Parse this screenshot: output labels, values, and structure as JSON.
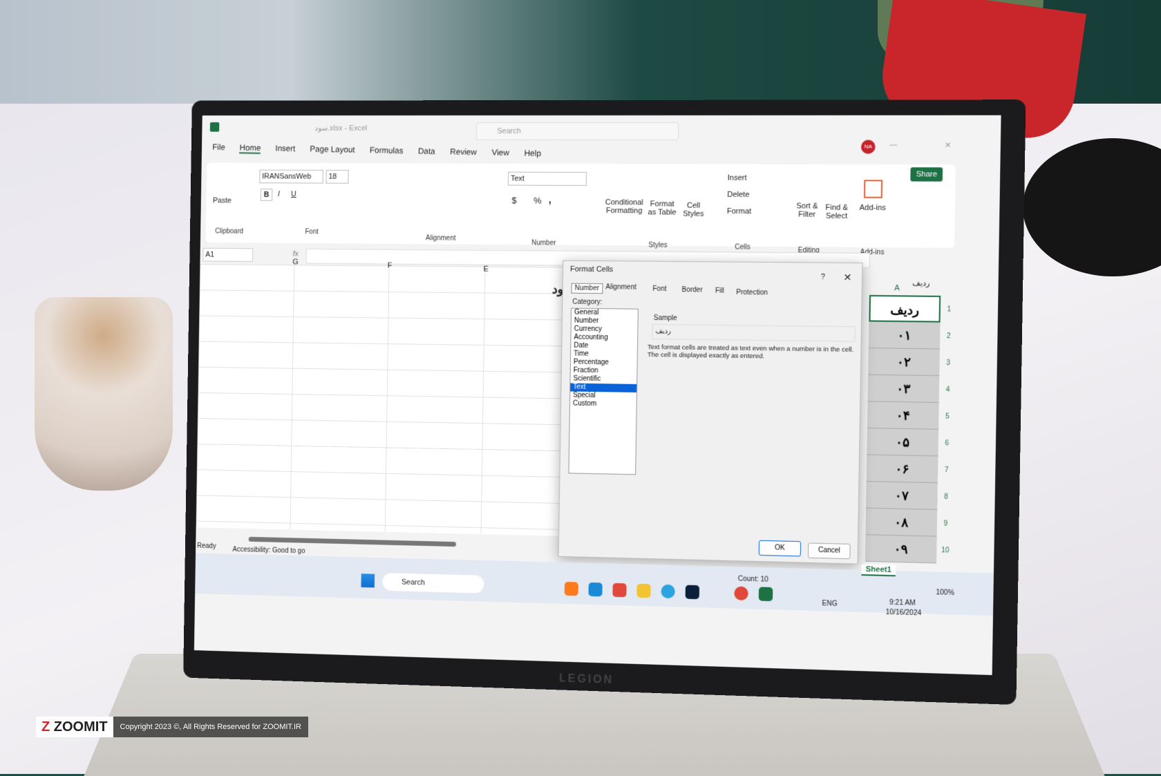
{
  "window": {
    "title": "سود.xlsx - Excel",
    "search_placeholder": "Search",
    "user_initials": "NA",
    "share_label": "Share"
  },
  "menu": [
    "File",
    "Home",
    "Insert",
    "Page Layout",
    "Formulas",
    "Data",
    "Review",
    "View",
    "Help"
  ],
  "ribbon": {
    "clipboard": {
      "paste": "Paste",
      "group": "Clipboard"
    },
    "font": {
      "name": "IRANSansWeb",
      "size": "18",
      "bold": "B",
      "italic": "I",
      "underline": "U",
      "group": "Font"
    },
    "alignment": {
      "group": "Alignment"
    },
    "number": {
      "format": "Text",
      "currency": "$",
      "percent": "%",
      "comma": ",",
      "group": "Number"
    },
    "styles": {
      "conditional": "Conditional Formatting",
      "format_table": "Format as Table",
      "cell_styles": "Cell Styles",
      "group": "Styles"
    },
    "cells": {
      "insert": "Insert",
      "delete": "Delete",
      "format": "Format",
      "group": "Cells"
    },
    "editing": {
      "sort": "Sort & Filter",
      "find": "Find & Select",
      "group": "Editing"
    },
    "addins": {
      "label": "Add-ins",
      "group": "Add-ins"
    }
  },
  "formula_bar": {
    "name_box": "A1",
    "fx": "fx",
    "right_name": "ردیف"
  },
  "columns": [
    "G",
    "F",
    "E",
    "A"
  ],
  "partial_cell": "ود",
  "rows": [
    "1",
    "2",
    "3",
    "4",
    "5",
    "6",
    "7",
    "8",
    "9",
    "10"
  ],
  "column_a": [
    "ردیف",
    "۰۱",
    "۰۲",
    "۰۳",
    "۰۴",
    "۰۵",
    "۰۶",
    "۰۷",
    "۰۸",
    "۰۹"
  ],
  "dialog": {
    "title": "Format Cells",
    "help": "?",
    "tabs": [
      "Number",
      "Alignment",
      "Font",
      "Border",
      "Fill",
      "Protection"
    ],
    "category_label": "Category:",
    "categories": [
      "General",
      "Number",
      "Currency",
      "Accounting",
      "Date",
      "Time",
      "Percentage",
      "Fraction",
      "Scientific",
      "Text",
      "Special",
      "Custom"
    ],
    "selected_category": "Text",
    "sample_label": "Sample",
    "sample_value": "ردیف",
    "description": "Text format cells are treated as text even when a number is in the cell. The cell is displayed exactly as entered.",
    "ok": "OK",
    "cancel": "Cancel"
  },
  "status": {
    "ready": "Ready",
    "accessibility": "Accessibility: Good to go",
    "count": "Count: 10",
    "zoom": "100%",
    "sheet": "Sheet1"
  },
  "taskbar": {
    "search": "Search",
    "lang": "ENG",
    "time": "9:21 AM",
    "date": "10/16/2024"
  },
  "laptop_brand": "LEGION",
  "watermark": {
    "logo": "ZOOMIT",
    "copyright": "Copyright 2023 ©, All Rights Reserved for ZOOMIT.IR"
  },
  "colors": {
    "excel_green": "#1e7145",
    "selection": "#0a64d8",
    "avatar": "#c4252b"
  }
}
